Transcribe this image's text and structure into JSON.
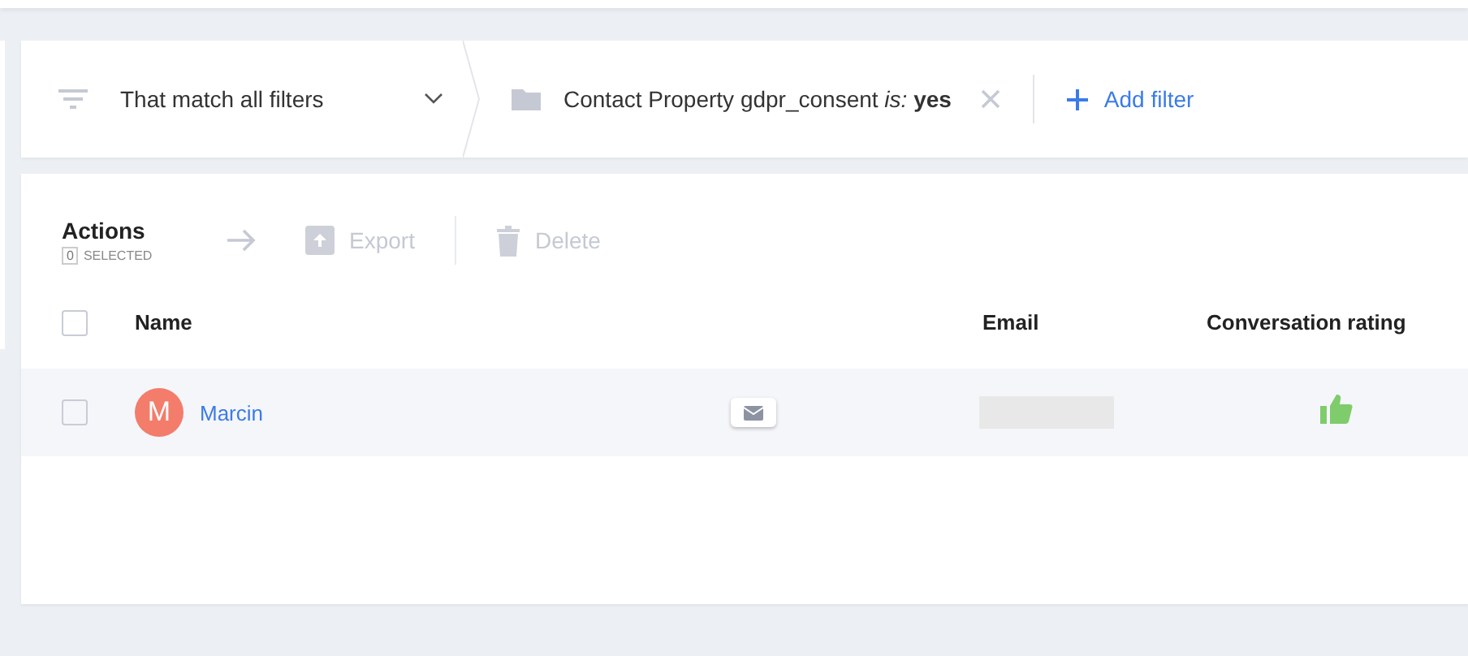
{
  "filter_bar": {
    "match_mode": "That match all filters",
    "filters": [
      {
        "text": "Contact Property gdpr_consent *is:* **yes**"
      }
    ],
    "add_filter": "Add filter"
  },
  "actions": {
    "title": "Actions",
    "selected_count": "0",
    "selected_label": "SELECTED",
    "buttons": [
      {
        "label": "Export",
        "disabled": true
      },
      {
        "label": "Delete",
        "disabled": true
      }
    ]
  },
  "table": {
    "select_all": {
      "checked": false
    },
    "columns": [
      "Name",
      "Email",
      "Conversation rating"
    ],
    "rows": [
      {
        "checked": false,
        "avatar_letter": "M",
        "color": "#f47c6b",
        "name": "Marcin",
        "email_redacted": true,
        "kind": "thumbs_up"
      }
    ]
  }
}
